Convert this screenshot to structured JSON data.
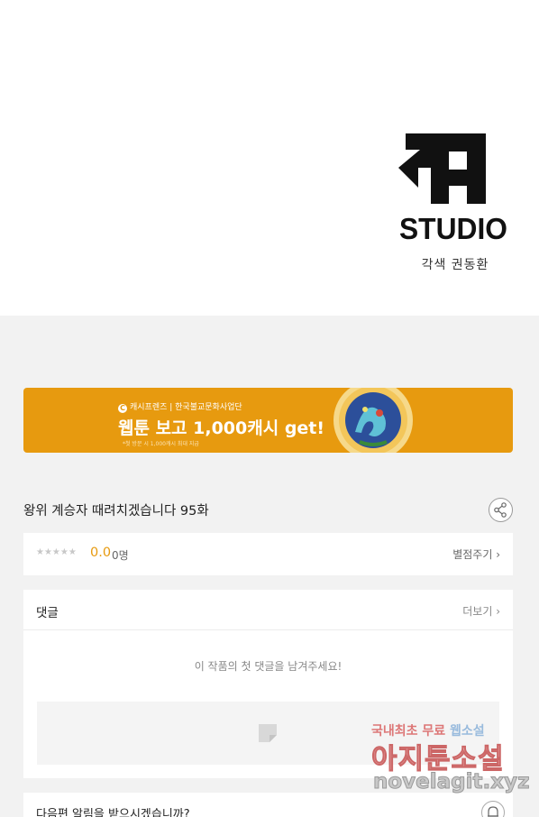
{
  "header": {
    "studio_logo_text": "STUDIO",
    "credit": "각색 권동환"
  },
  "banner": {
    "brand": "캐시프렌즈 | 한국불교문화사업단",
    "headline": "웹툰 보고 1,000캐시 get!",
    "note": "*첫 방문 시 1,000캐시 최대 지급",
    "accent_color": "#e79a0f"
  },
  "episode": {
    "title": "왕위 계승자 때려치겠습니다 95화",
    "share_icon": "share-icon"
  },
  "rating": {
    "stars": "★★★★★",
    "score": "0.0",
    "count": "0명",
    "rate_link": "별점주기 ›"
  },
  "comments": {
    "label": "댓글",
    "more_link": "더보기 ›",
    "empty_message": "이 작품의 첫 댓글을 남겨주세요!"
  },
  "notify": {
    "question": "다음편 알림을 받으시겠습니까?",
    "bell_icon": "bell-icon"
  },
  "watermark": {
    "line1_prefix": "국내최초 무료 ",
    "line1_highlight": "웹소설",
    "line2": "아지툰소설",
    "line3": "novelagit.xyz"
  }
}
